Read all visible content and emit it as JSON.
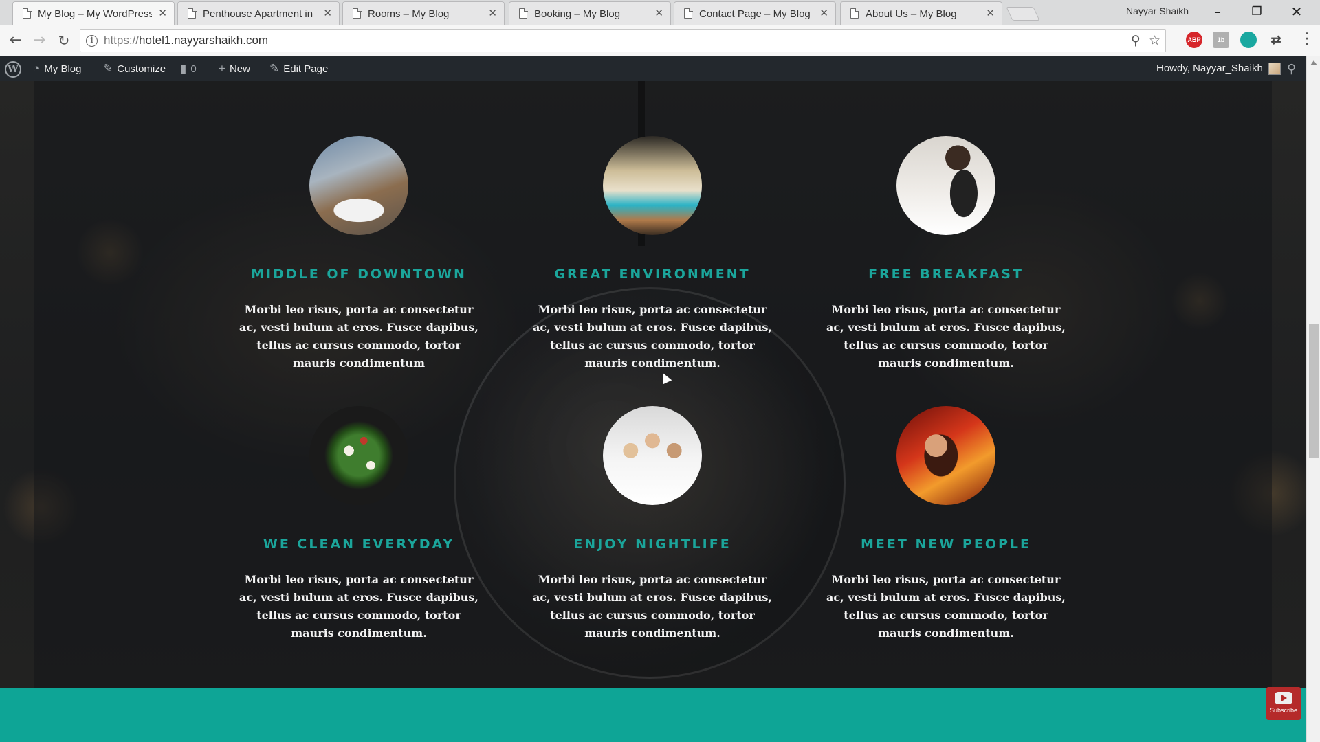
{
  "browser": {
    "tabs": [
      {
        "title": "My Blog – My WordPress",
        "active": true
      },
      {
        "title": "Penthouse Apartment in",
        "active": false
      },
      {
        "title": "Rooms – My Blog",
        "active": false
      },
      {
        "title": "Booking – My Blog",
        "active": false
      },
      {
        "title": "Contact Page – My Blog",
        "active": false
      },
      {
        "title": "About Us – My Blog",
        "active": false
      }
    ],
    "profile_name": "Nayyar Shaikh",
    "url_scheme": "https://",
    "url_host": "hotel1.nayyarshaikh.com",
    "extensions": [
      "ABP",
      "1b"
    ]
  },
  "adminbar": {
    "site_name": "My Blog",
    "customize": "Customize",
    "comments_count": "0",
    "new_label": "New",
    "edit_page": "Edit Page",
    "howdy": "Howdy, Nayyar_Shaikh"
  },
  "features": [
    {
      "title": "MIDDLE OF DOWNTOWN",
      "text": "Morbi leo risus, porta ac consectetur ac, vesti bulum at eros. Fusce dapibus, tellus ac cursus commodo, tortor mauris condimentum"
    },
    {
      "title": "GREAT ENVIRONMENT",
      "text": "Morbi leo risus, porta ac consectetur ac, vesti bulum at eros. Fusce dapibus, tellus ac cursus commodo, tortor mauris condimentum."
    },
    {
      "title": "FREE BREAKFAST",
      "text": "Morbi leo risus, porta ac consectetur ac, vesti bulum at eros. Fusce dapibus, tellus ac cursus commodo, tortor mauris condimentum."
    },
    {
      "title": "WE CLEAN EVERYDAY",
      "text": "Morbi leo risus, porta ac consectetur ac, vesti bulum at eros. Fusce dapibus, tellus ac cursus commodo, tortor mauris condimentum."
    },
    {
      "title": "ENJOY NIGHTLIFE",
      "text": "Morbi leo risus, porta ac consectetur ac, vesti bulum at eros. Fusce dapibus, tellus ac cursus commodo, tortor mauris condimentum."
    },
    {
      "title": "MEET NEW PEOPLE",
      "text": "Morbi leo risus, porta ac consectetur ac, vesti bulum at eros. Fusce dapibus, tellus ac cursus commodo, tortor mauris condimentum."
    }
  ],
  "subscribe_label": "Subscribe",
  "colors": {
    "accent_teal": "#1ba59b",
    "band_teal": "#0ea596",
    "adminbar": "#23282d"
  }
}
